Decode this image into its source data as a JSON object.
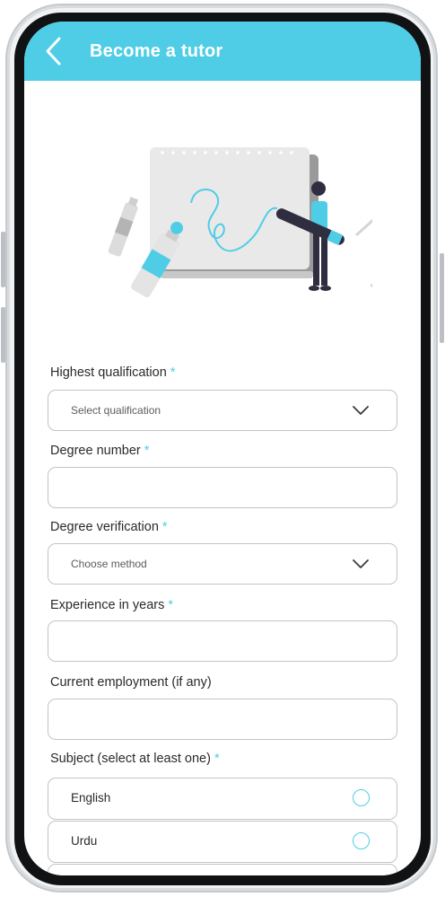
{
  "header": {
    "title": "Become a tutor",
    "back_icon": "chevron-left-icon",
    "color": "#4fcde6"
  },
  "form": {
    "qualification": {
      "label": "Highest qualification",
      "required_mark": "*",
      "placeholder": "Select qualification"
    },
    "degree_number": {
      "label": "Degree number",
      "required_mark": "*",
      "value": ""
    },
    "degree_verification": {
      "label": "Degree verification",
      "required_mark": "*",
      "placeholder": "Choose method"
    },
    "experience": {
      "label": "Experience in years",
      "required_mark": "*",
      "value": ""
    },
    "employment": {
      "label": "Current employment (if any)",
      "value": ""
    },
    "subjects": {
      "label": "Subject (select at least one)",
      "required_mark": "*",
      "options": [
        {
          "label": "English",
          "selected": false
        },
        {
          "label": "Urdu",
          "selected": false
        }
      ]
    }
  },
  "colors": {
    "accent": "#4fcde6",
    "border": "#c4c4c4",
    "text": "#2a2a2a"
  }
}
